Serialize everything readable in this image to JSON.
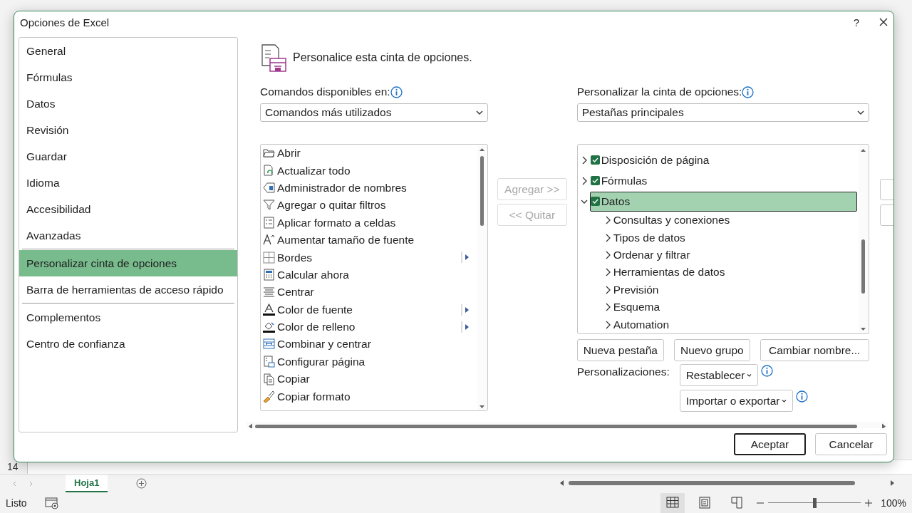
{
  "window": {
    "title": "Opciones de Excel",
    "help": "?"
  },
  "sidebar": {
    "sections": [
      [
        {
          "label": "General",
          "selected": false
        },
        {
          "label": "Fórmulas",
          "selected": false
        },
        {
          "label": "Datos",
          "selected": false
        },
        {
          "label": "Revisión",
          "selected": false
        },
        {
          "label": "Guardar",
          "selected": false
        },
        {
          "label": "Idioma",
          "selected": false
        },
        {
          "label": "Accesibilidad",
          "selected": false
        },
        {
          "label": "Avanzadas",
          "selected": false
        }
      ],
      [
        {
          "label": "Personalizar cinta de opciones",
          "selected": true
        },
        {
          "label": "Barra de herramientas de acceso rápido",
          "selected": false
        }
      ],
      [
        {
          "label": "Complementos",
          "selected": false
        },
        {
          "label": "Centro de confianza",
          "selected": false
        }
      ]
    ]
  },
  "header": {
    "title": "Personalice esta cinta de opciones."
  },
  "commands": {
    "label": "Comandos disponibles en:",
    "dropdown": "Comandos más utilizados",
    "items": [
      {
        "label": "Abrir",
        "submenu": false
      },
      {
        "label": "Actualizar todo",
        "submenu": false
      },
      {
        "label": "Administrador de nombres",
        "submenu": false
      },
      {
        "label": "Agregar o quitar filtros",
        "submenu": false
      },
      {
        "label": "Aplicar formato a celdas",
        "submenu": false
      },
      {
        "label": "Aumentar tamaño de fuente",
        "submenu": false
      },
      {
        "label": "Bordes",
        "submenu": true
      },
      {
        "label": "Calcular ahora",
        "submenu": false
      },
      {
        "label": "Centrar",
        "submenu": false
      },
      {
        "label": "Color de fuente",
        "submenu": true
      },
      {
        "label": "Color de relleno",
        "submenu": true
      },
      {
        "label": "Combinar y centrar",
        "submenu": false
      },
      {
        "label": "Configurar página",
        "submenu": false
      },
      {
        "label": "Copiar",
        "submenu": false
      },
      {
        "label": "Copiar formato",
        "submenu": false
      }
    ]
  },
  "transfer_buttons": [
    {
      "label": "Agregar >>",
      "disabled": true
    },
    {
      "label": "<< Quitar",
      "disabled": true
    }
  ],
  "ribbon": {
    "label": "Personalizar la cinta de opciones:",
    "dropdown": "Pestañas principales",
    "tabs": [
      {
        "label": "Disposición de página",
        "checked": true,
        "expanded": false,
        "selected": false
      },
      {
        "label": "Fórmulas",
        "checked": true,
        "expanded": false,
        "selected": false
      },
      {
        "label": "Datos",
        "checked": true,
        "expanded": true,
        "selected": true,
        "children": [
          {
            "label": "Consultas y conexiones",
            "expanded": false,
            "selected": false
          },
          {
            "label": "Tipos de datos",
            "expanded": false,
            "selected": false
          },
          {
            "label": "Ordenar y filtrar",
            "expanded": false,
            "selected": false
          },
          {
            "label": "Herramientas de datos",
            "expanded": false,
            "selected": false
          },
          {
            "label": "Previsión",
            "expanded": false,
            "selected": false
          },
          {
            "label": "Esquema",
            "expanded": false,
            "selected": false
          },
          {
            "label": "Automation",
            "expanded": false,
            "selected": false
          }
        ]
      }
    ]
  },
  "ribbon_buttons": [
    "Nueva pestaña",
    "Nuevo grupo",
    "Cambiar nombre..."
  ],
  "customizations": {
    "label": "Personalizaciones:",
    "reset": "Restablecer",
    "import_export": "Importar o exportar"
  },
  "footer_buttons": [
    {
      "label": "Aceptar",
      "default": true
    },
    {
      "label": "Cancelar",
      "default": false
    }
  ],
  "sheet": {
    "row_header": "14",
    "tabs": [
      {
        "label": "Hoja1",
        "selected": true
      }
    ]
  },
  "status_bar": {
    "status": "Listo",
    "views": [
      {
        "kind": "normal",
        "selected": true
      },
      {
        "kind": "page_layout",
        "selected": false
      },
      {
        "kind": "page_break",
        "selected": false
      }
    ],
    "zoom": {
      "level": 0.5,
      "reading": "100%"
    }
  }
}
